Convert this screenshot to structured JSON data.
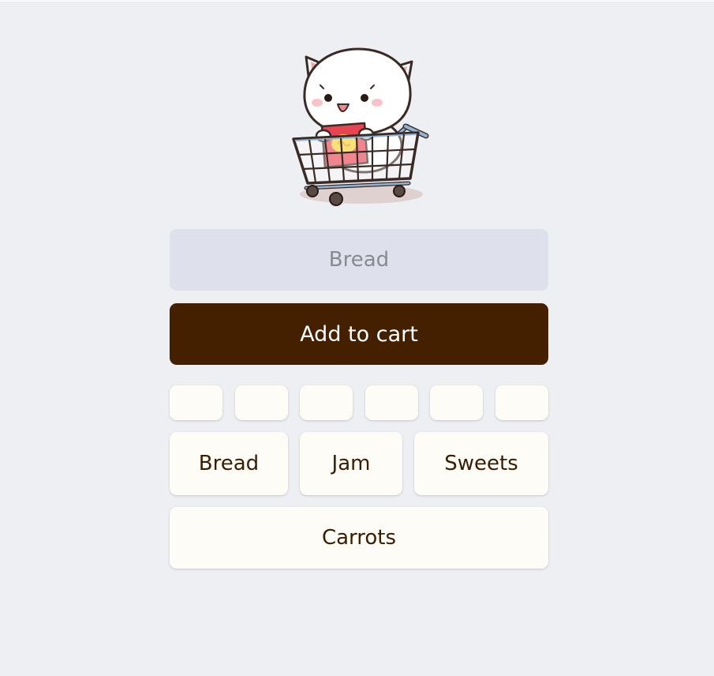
{
  "mascot": {
    "icon": "cat-in-shopping-cart-icon"
  },
  "item_input": {
    "placeholder": "Bread",
    "value": ""
  },
  "add_button": {
    "label": "Add to cart"
  },
  "empty_chips": [
    "",
    "",
    "",
    "",
    "",
    ""
  ],
  "suggestions": {
    "bread": "Bread",
    "jam": "Jam",
    "sweets": "Sweets",
    "carrots": "Carrots"
  },
  "colors": {
    "background": "#eeeff3",
    "input_bg": "#dee1ec",
    "button_bg": "#452000",
    "chip_bg": "#fdfcf7",
    "chip_text": "#3a1d00"
  }
}
